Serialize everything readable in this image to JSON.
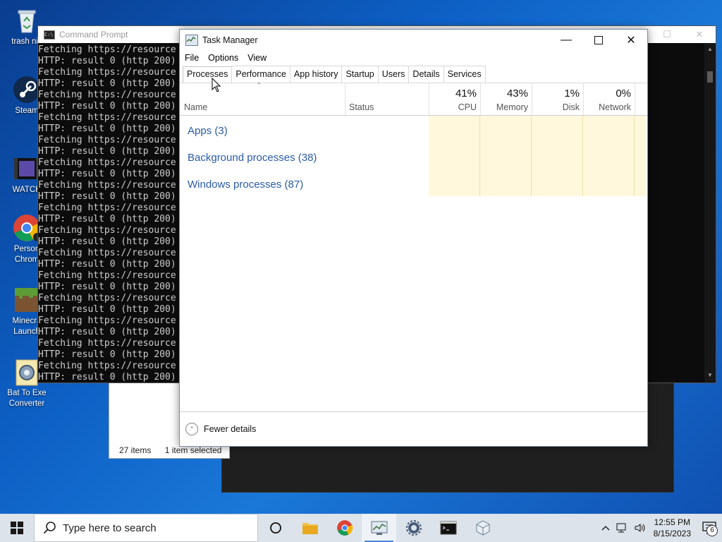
{
  "desktop": {
    "icons": [
      {
        "label": "trash nic",
        "icon": "recycle-bin-icon"
      },
      {
        "label": "Steam",
        "icon": "steam-icon"
      },
      {
        "label": "WATCH",
        "icon": "video-file-icon"
      },
      {
        "label": "Person",
        "label2": "Chrom",
        "icon": "chrome-icon"
      },
      {
        "label": "Minecra",
        "label2": "Launch",
        "icon": "minecraft-icon"
      },
      {
        "label": "Bat To Exe",
        "label2": "Converter",
        "icon": "bat-to-exe-icon"
      }
    ]
  },
  "explorer": {
    "item_count": "27 items",
    "selected": "1 item selected"
  },
  "cmd": {
    "title": "Command Prompt",
    "line_a": "Fetching https://resource",
    "line_b": "HTTP: result 0 (http 200)",
    "repeat_pairs": 15
  },
  "task_manager": {
    "title": "Task Manager",
    "menu": [
      "File",
      "Options",
      "View"
    ],
    "tabs": [
      "Processes",
      "Performance",
      "App history",
      "Startup",
      "Users",
      "Details",
      "Services"
    ],
    "active_tab": "Processes",
    "columns": {
      "name": "Name",
      "status": "Status",
      "cpu": {
        "pct": "41%",
        "label": "CPU"
      },
      "memory": {
        "pct": "43%",
        "label": "Memory"
      },
      "disk": {
        "pct": "1%",
        "label": "Disk"
      },
      "network": {
        "pct": "0%",
        "label": "Network"
      }
    },
    "groups": [
      "Apps (3)",
      "Background processes (38)",
      "Windows processes (87)"
    ],
    "footer": "Fewer details"
  },
  "taskbar": {
    "search_placeholder": "Type here to search",
    "time": "12:55 PM",
    "date": "8/15/2023",
    "notification_count": "6",
    "accent": "#4a88d8"
  }
}
